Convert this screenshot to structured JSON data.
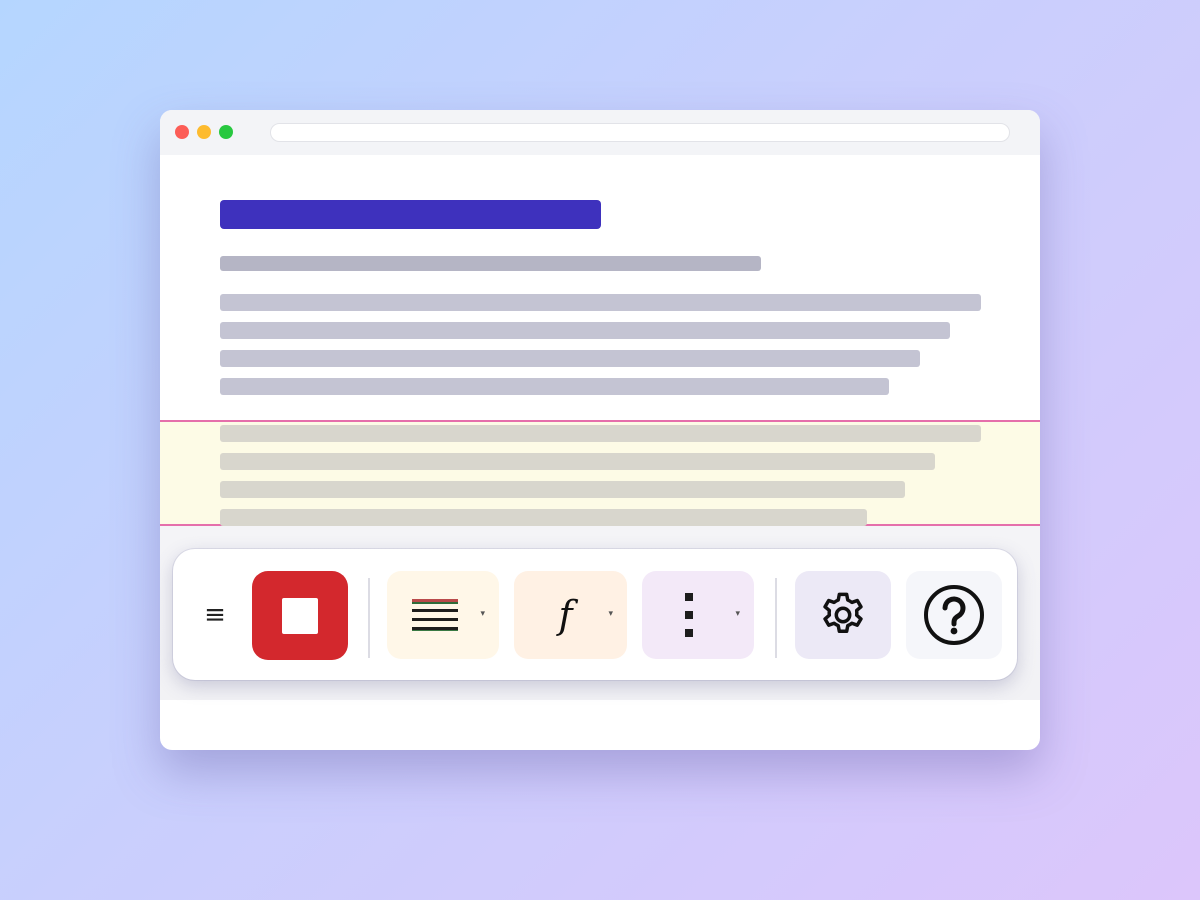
{
  "toolbar": {
    "menu_icon": "hamburger-menu-icon",
    "menu_glyph": "≡",
    "stop_icon": "stop-icon",
    "lines_icon": "text-lines-icon",
    "font_icon": "function-font-icon",
    "font_glyph": "f",
    "more_icon": "vertical-dots-icon",
    "gear_icon": "gear-icon",
    "help_icon": "help-circle-icon",
    "caret_glyph": "▾"
  },
  "colors": {
    "title_accent": "#3e31bd",
    "stop_button": "#d3282d",
    "highlight_border": "#e56fab",
    "highlight_fill": "#fdfbe6"
  }
}
